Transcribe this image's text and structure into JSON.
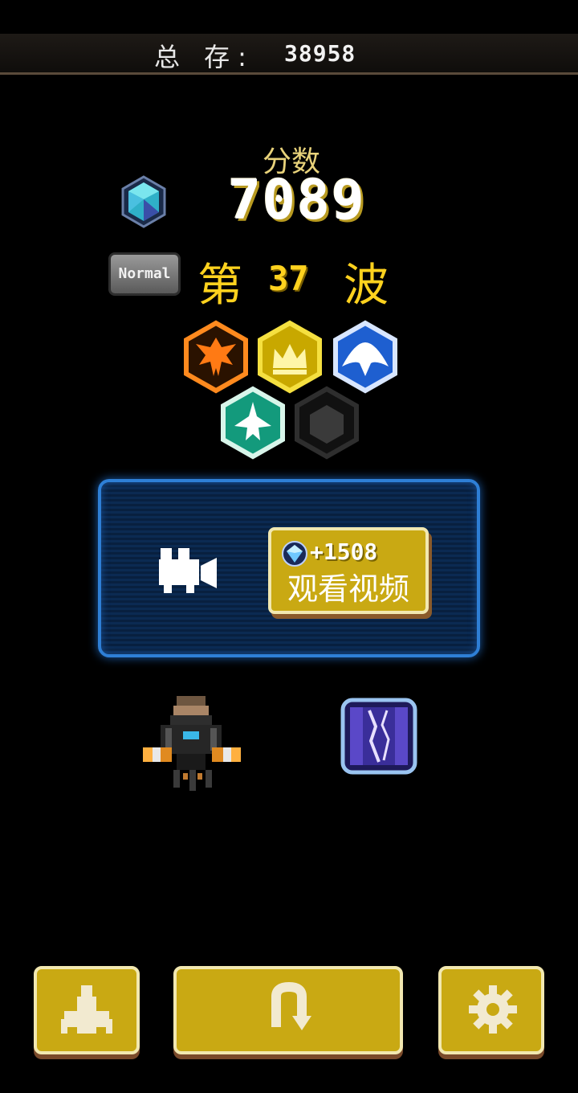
{
  "header": {
    "total_label": "总 存:",
    "total_value": "38958"
  },
  "score": {
    "label": "分数",
    "value": "7089"
  },
  "wave": {
    "difficulty": "Normal",
    "prefix": "第",
    "number": "37",
    "suffix": "波"
  },
  "badges": [
    {
      "icon": "phoenix-icon",
      "color": "#ff7a14",
      "state": "earned"
    },
    {
      "icon": "crown-icon",
      "color": "#f0d020",
      "state": "earned"
    },
    {
      "icon": "manta-icon",
      "color": "#1e5fd0",
      "state": "earned"
    },
    {
      "icon": "fighter-icon",
      "color": "#1fb090",
      "state": "earned"
    },
    {
      "icon": "empty-slot-icon",
      "color": "#3a3a3a",
      "state": "locked"
    }
  ],
  "reward": {
    "amount": "+1508",
    "watch_label": "观看视频",
    "icon": "video-camera-icon"
  },
  "items": {
    "ship": "player-ship-icon",
    "powerup": "lightning-powerup-icon"
  },
  "buttons": [
    {
      "name": "hangar-button",
      "icon": "ship-silhouette-icon"
    },
    {
      "name": "restart-button",
      "icon": "restart-icon"
    },
    {
      "name": "settings-button",
      "icon": "gear-icon"
    }
  ],
  "colors": {
    "accent": "#ffd21e",
    "button": "#c9a913",
    "panel_border": "#2e7fd6"
  }
}
